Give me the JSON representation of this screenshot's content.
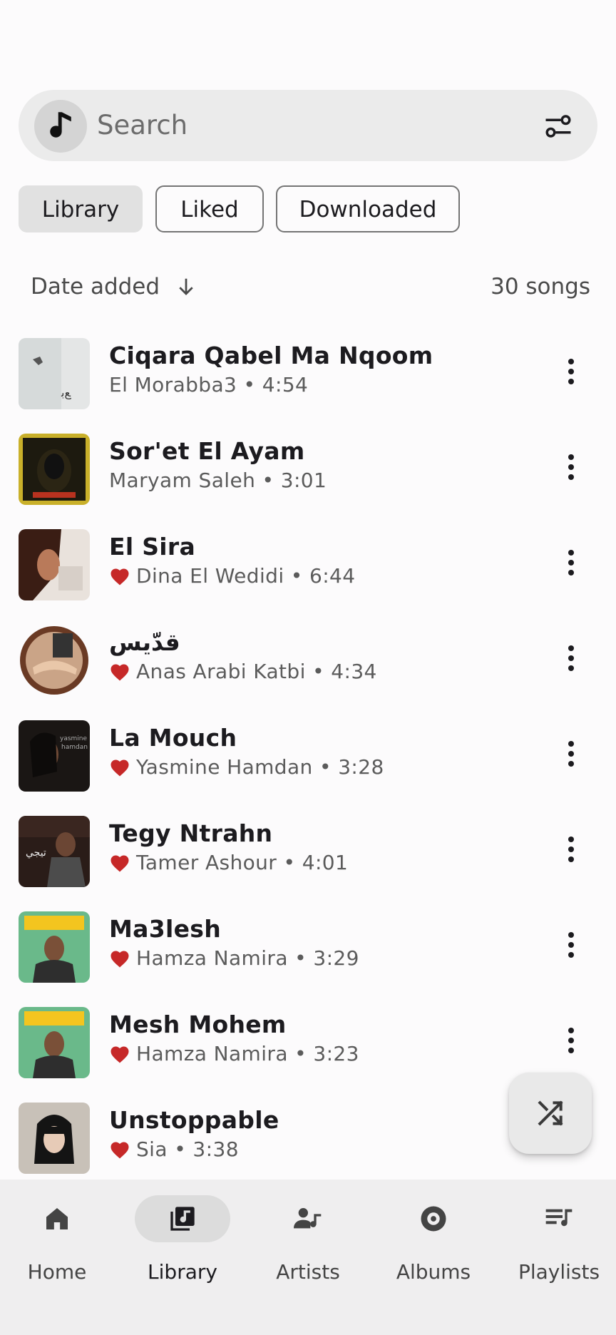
{
  "search": {
    "placeholder": "Search"
  },
  "chips": [
    {
      "label": "Library",
      "selected": true
    },
    {
      "label": "Liked",
      "selected": false
    },
    {
      "label": "Downloaded",
      "selected": false
    }
  ],
  "sort": {
    "label": "Date added",
    "count": "30 songs"
  },
  "songs": [
    {
      "title": "Ciqara Qabel Ma Nqoom",
      "subtitle": "El Morabba3 • 4:54",
      "liked": false
    },
    {
      "title": "Sor'et El Ayam",
      "subtitle": "Maryam Saleh • 3:01",
      "liked": false
    },
    {
      "title": "El Sira",
      "subtitle": "Dina El Wedidi • 6:44",
      "liked": true
    },
    {
      "title": "قدّيس",
      "subtitle": "Anas Arabi Katbi • 4:34",
      "liked": true
    },
    {
      "title": "La Mouch",
      "subtitle": "Yasmine Hamdan • 3:28",
      "liked": true
    },
    {
      "title": "Tegy Ntrahn",
      "subtitle": "Tamer Ashour • 4:01",
      "liked": true
    },
    {
      "title": "Ma3lesh",
      "subtitle": "Hamza Namira • 3:29",
      "liked": true
    },
    {
      "title": "Mesh Mohem",
      "subtitle": "Hamza Namira • 3:23",
      "liked": true
    },
    {
      "title": "Unstoppable",
      "subtitle": "Sia • 3:38",
      "liked": true
    }
  ],
  "nav": [
    {
      "label": "Home",
      "icon": "home-icon",
      "active": false
    },
    {
      "label": "Library",
      "icon": "library-music-icon",
      "active": true
    },
    {
      "label": "Artists",
      "icon": "artist-icon",
      "active": false
    },
    {
      "label": "Albums",
      "icon": "album-icon",
      "active": false
    },
    {
      "label": "Playlists",
      "icon": "playlist-icon",
      "active": false
    }
  ],
  "colors": {
    "heart": "#c62828",
    "background": "#fcfbfc",
    "navbar": "#efeeef"
  }
}
